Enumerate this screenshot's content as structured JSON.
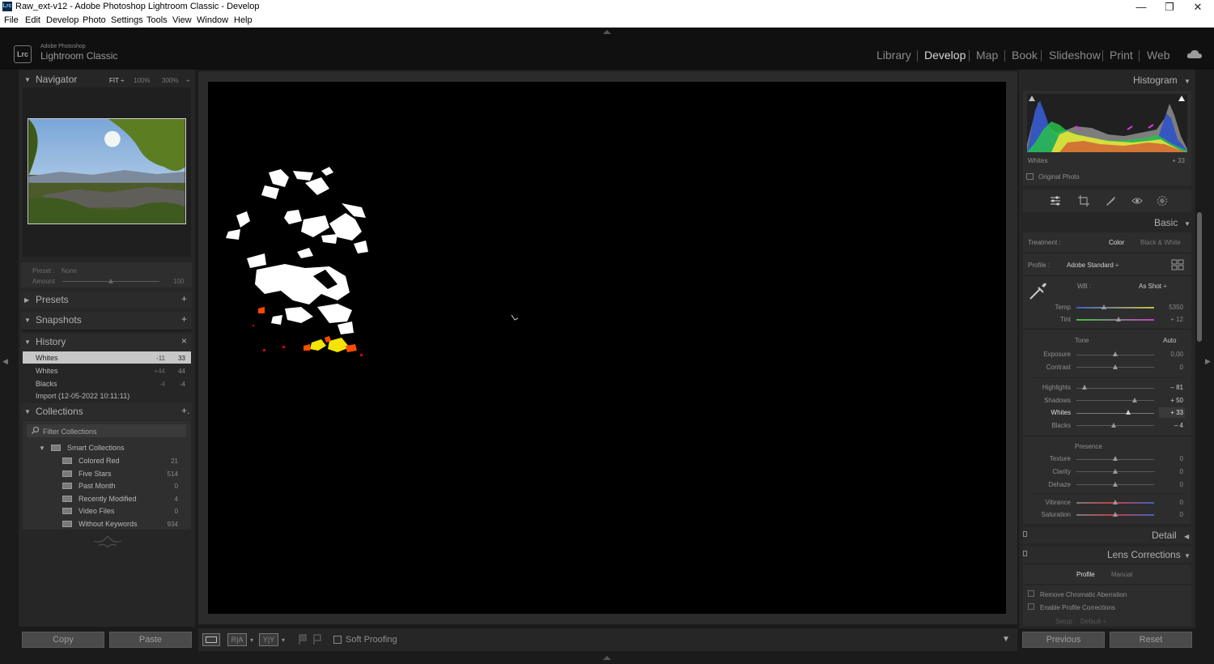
{
  "window": {
    "app_icon_text": "Lrc",
    "title": "Raw_ext-v12 - Adobe Photoshop Lightroom Classic - Develop",
    "min": "—",
    "max": "❐",
    "close": "✕"
  },
  "menu": [
    "File",
    "Edit",
    "Develop",
    "Photo",
    "Settings",
    "Tools",
    "View",
    "Window",
    "Help"
  ],
  "brand": {
    "logo": "Lrc",
    "line1": "Adobe Photoshop",
    "line2": "Lightroom Classic"
  },
  "modules": [
    {
      "label": "Library",
      "active": false
    },
    {
      "label": "Develop",
      "active": true
    },
    {
      "label": "Map",
      "active": false
    },
    {
      "label": "Book",
      "active": false
    },
    {
      "label": "Slideshow",
      "active": false
    },
    {
      "label": "Print",
      "active": false
    },
    {
      "label": "Web",
      "active": false
    }
  ],
  "left": {
    "navigator": {
      "title": "Navigator",
      "zoom": [
        "FIT ÷",
        "100%",
        "300%",
        "÷"
      ]
    },
    "preset": {
      "label": "Preset :",
      "value": "None",
      "amount_label": "Amount",
      "amount_value": "100"
    },
    "presets": {
      "title": "Presets",
      "action": "+"
    },
    "snapshots": {
      "title": "Snapshots",
      "action": "+"
    },
    "history": {
      "title": "History",
      "action": "×",
      "items": [
        {
          "label": "Whites",
          "a": "-11",
          "b": "33",
          "selected": true
        },
        {
          "label": "Whites",
          "a": "+44",
          "b": "44",
          "selected": false
        },
        {
          "label": "Blacks",
          "a": "-4",
          "b": "-4",
          "selected": false
        },
        {
          "label": "Import (12-05-2022 10:11:11)",
          "a": "",
          "b": "",
          "selected": false
        }
      ]
    },
    "collections": {
      "title": "Collections",
      "action": "+.",
      "filter_placeholder": "Filter Collections",
      "smart_title": "Smart Collections",
      "items": [
        {
          "label": "Colored Red",
          "count": "21"
        },
        {
          "label": "Five Stars",
          "count": "514"
        },
        {
          "label": "Past Month",
          "count": "0"
        },
        {
          "label": "Recently Modified",
          "count": "4"
        },
        {
          "label": "Video Files",
          "count": "0"
        },
        {
          "label": "Without Keywords",
          "count": "934"
        }
      ]
    },
    "copy": "Copy",
    "paste": "Paste"
  },
  "toolbar": {
    "soft_proofing": "Soft Proofing",
    "compare_label": "R|A",
    "survey_label": "Y|Y"
  },
  "right": {
    "histogram": {
      "title": "Histogram",
      "readout_label": "Whites",
      "readout_value": "+ 33",
      "original": "Original Photo"
    },
    "tool_icons": [
      "sliders-icon",
      "crop-icon",
      "brush-icon",
      "redeye-icon",
      "mask-icon"
    ],
    "basic": {
      "title": "Basic",
      "treatment_label": "Treatment :",
      "treatment_color": "Color",
      "treatment_bw": "Black & White",
      "profile_label": "Profile :",
      "profile_value": "Adobe Standard ÷",
      "wb_label": "WB :",
      "wb_value": "As Shot ÷",
      "tone_label": "Tone",
      "auto_label": "Auto",
      "presence_label": "Presence"
    },
    "wb_sliders": [
      {
        "label": "Temp",
        "value": "5350",
        "level": 0.35
      },
      {
        "label": "Tint",
        "value": "+ 12",
        "level": 0.54
      }
    ],
    "tone_sliders": [
      {
        "label": "Exposure",
        "value": "0,00",
        "level": 0.5
      },
      {
        "label": "Contrast",
        "value": "0",
        "level": 0.5
      }
    ],
    "tone_sliders2": [
      {
        "label": "Highlights",
        "value": "– 81",
        "level": 0.1,
        "active": false
      },
      {
        "label": "Shadows",
        "value": "+ 50",
        "level": 0.75,
        "active": false
      },
      {
        "label": "Whites",
        "value": "+ 33",
        "level": 0.67,
        "active": true
      },
      {
        "label": "Blacks",
        "value": "– 4",
        "level": 0.48,
        "active": false
      }
    ],
    "presence_sliders": [
      {
        "label": "Texture",
        "value": "0",
        "level": 0.5
      },
      {
        "label": "Clarity",
        "value": "0",
        "level": 0.5
      },
      {
        "label": "Dehaze",
        "value": "0",
        "level": 0.5
      }
    ],
    "presence_sliders2": [
      {
        "label": "Vibrance",
        "value": "0",
        "level": 0.5
      },
      {
        "label": "Saturation",
        "value": "0",
        "level": 0.5
      }
    ],
    "detail": {
      "title": "Detail"
    },
    "lens": {
      "title": "Lens Corrections",
      "tab_profile": "Profile",
      "tab_manual": "Manual",
      "chk1": "Remove Chromatic Aberration",
      "chk2": "Enable Profile Corrections",
      "setup_label": "Setup",
      "setup_value": "Default ÷"
    },
    "previous": "Previous",
    "reset": "Reset"
  }
}
